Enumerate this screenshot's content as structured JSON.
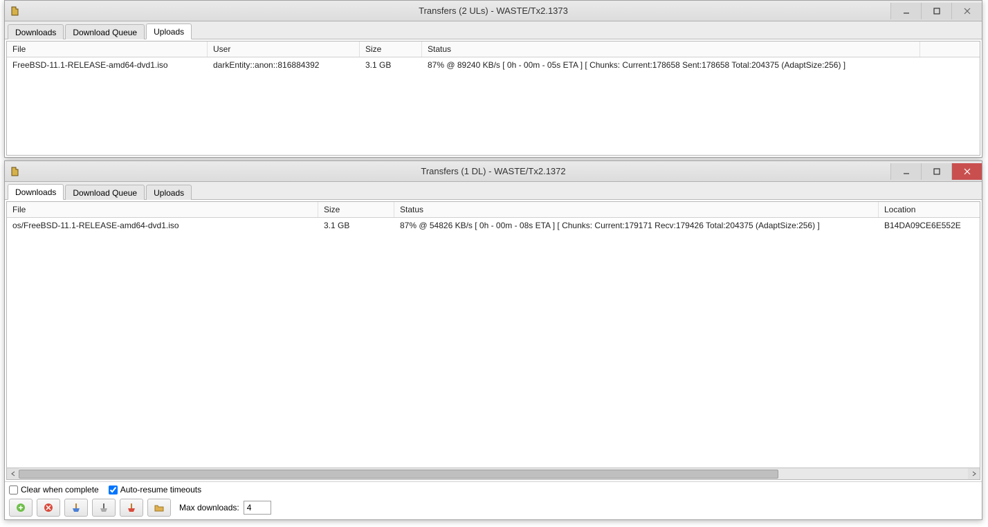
{
  "window1": {
    "title": "Transfers (2 ULs) - WASTE/Tx2.1373",
    "tabs": {
      "downloads": "Downloads",
      "queue": "Download Queue",
      "uploads": "Uploads"
    },
    "active_tab": "uploads",
    "headers": {
      "file": "File",
      "user": "User",
      "size": "Size",
      "status": "Status"
    },
    "row": {
      "file": "FreeBSD-11.1-RELEASE-amd64-dvd1.iso",
      "user": "darkEntity::anon::816884392",
      "size": "3.1 GB",
      "status": "87% @ 89240 KB/s [ 0h - 00m - 05s ETA ] [ Chunks: Current:178658 Sent:178658 Total:204375 (AdaptSize:256) ]"
    }
  },
  "window2": {
    "title": "Transfers (1 DL) - WASTE/Tx2.1372",
    "tabs": {
      "downloads": "Downloads",
      "queue": "Download Queue",
      "uploads": "Uploads"
    },
    "active_tab": "downloads",
    "headers": {
      "file": "File",
      "size": "Size",
      "status": "Status",
      "location": "Location"
    },
    "row": {
      "file": "os/FreeBSD-11.1-RELEASE-amd64-dvd1.iso",
      "size": "3.1 GB",
      "status": "87% @ 54826 KB/s [ 0h - 00m - 08s ETA ] [ Chunks: Current:179171 Recv:179426 Total:204375 (AdaptSize:256) ]",
      "location": "B14DA09CE6E552E"
    },
    "options": {
      "clear_complete_label": "Clear when complete",
      "clear_complete_checked": false,
      "auto_resume_label": "Auto-resume timeouts",
      "auto_resume_checked": true,
      "max_downloads_label": "Max downloads:",
      "max_downloads_value": "4"
    }
  }
}
